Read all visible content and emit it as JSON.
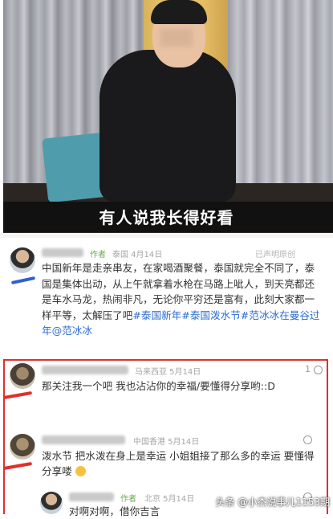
{
  "video": {
    "caption": "有人说我长得好看"
  },
  "post": {
    "author_tag": "作者",
    "location_date": "泰国 4月14日",
    "status": "已声明原创",
    "text": "中国新年是走亲串友，在家喝酒聚餐，泰国就完全不同了，泰国是集体出动，从上午就拿着水枪在马路上呲人，到天亮都还是车水马龙，热闹非凡，无论你平穷还是富有，此刻大家都一样平等，太解压了吧",
    "hashtags": "#泰国新年#泰国泼水节#范冰冰在曼谷过年@范冰冰"
  },
  "comments": [
    {
      "location_date": "马来西亚 5月14日",
      "likes": "1",
      "text": "那关注我一个吧 我也沾沾你的幸福/要懂得分享哟::D"
    },
    {
      "location_date": "中国香港 5月14日",
      "likes": "",
      "text": "泼水节 把水泼在身上是幸运 小姐姐接了那么多的幸运 要懂得分享喽"
    },
    {
      "author_tag": "作者",
      "location_date": "北京 5月14日",
      "likes": "",
      "text": "对啊对啊，借你吉言"
    }
  ],
  "watermark": "头条 @小杰说事儿1153期",
  "colors": {
    "annotation_red": "#e0302a",
    "author_tag_green": "#6aa84f",
    "hashtag_blue": "#2a6bd1",
    "caption_bg": "#111111"
  },
  "icons": [
    "heart-icon",
    "smile-emoji-icon"
  ]
}
